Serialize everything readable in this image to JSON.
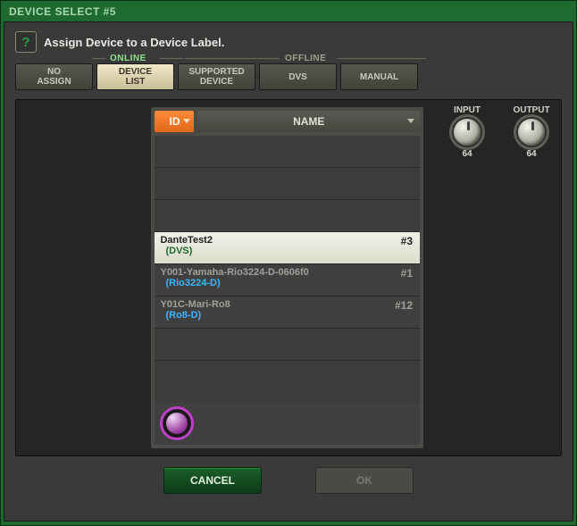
{
  "window": {
    "title": "DEVICE SELECT #5"
  },
  "instruction": "Assign Device to a Device Label.",
  "sections": {
    "online": "ONLINE",
    "offline": "OFFLINE"
  },
  "tabs": {
    "no_assign": "NO\nASSIGN",
    "device_list": "DEVICE\nLIST",
    "supported": "SUPPORTED\nDEVICE",
    "dvs": "DVS",
    "manual": "MANUAL"
  },
  "columns": {
    "id": "ID",
    "name": "NAME"
  },
  "devices": [
    {
      "name": "DanteTest2",
      "type": "(DVS)",
      "id": "#3",
      "selected": true
    },
    {
      "name": "Y001-Yamaha-Rio3224-D-0606f0",
      "type": "(Rio3224-D)",
      "id": "#1",
      "selected": false
    },
    {
      "name": "Y01C-Mari-Ro8",
      "type": "(Ro8-D)",
      "id": "#12",
      "selected": false
    }
  ],
  "io": {
    "input": {
      "label": "INPUT",
      "value": "64"
    },
    "output": {
      "label": "OUTPUT",
      "value": "64"
    }
  },
  "buttons": {
    "cancel": "CANCEL",
    "ok": "OK"
  }
}
